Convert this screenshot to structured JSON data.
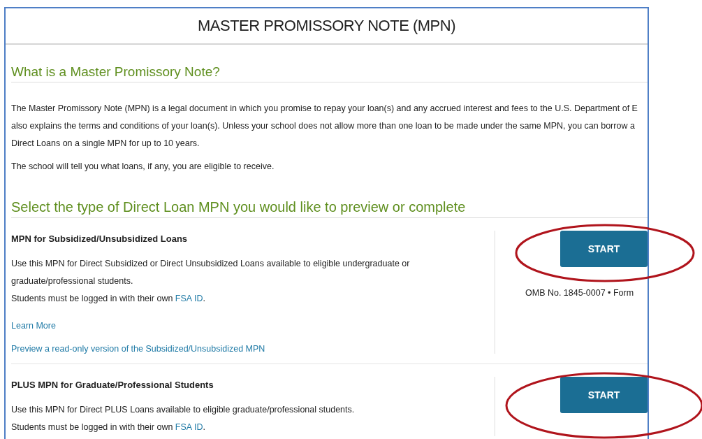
{
  "page_title": "MASTER PROMISSORY NOTE (MPN)",
  "intro": {
    "heading": "What is a Master Promissory Note?",
    "paragraph_lines": [
      "The Master Promissory Note (MPN) is a legal document in which you promise to repay your loan(s) and any accrued interest and fees to the U.S. Department of E",
      "also explains the terms and conditions of your loan(s). Unless your school does not allow more than one loan to be made under the same MPN, you can borrow a",
      "Direct Loans on a single MPN for up to 10 years."
    ],
    "note": "The school will tell you what loans, if any, you are eligible to receive."
  },
  "select_heading": "Select the type of Direct Loan MPN you would like to preview or complete",
  "mpn_options": [
    {
      "title": "MPN for Subsidized/Unsubsidized Loans",
      "description_lines": [
        "Use this MPN for Direct Subsidized or Direct Unsubsidized Loans available to eligible undergraduate or",
        "graduate/professional students."
      ],
      "login_text": "Students must be logged in with their own",
      "login_link": "FSA ID",
      "login_end": ".",
      "links": [
        "Learn More",
        "Preview a read-only version of the Subsidized/Unsubsidized MPN"
      ],
      "button": "START",
      "form_info": "OMB No. 1845-0007 • Form"
    },
    {
      "title": "PLUS MPN for Graduate/Professional Students",
      "description_lines": [
        "Use this MPN for Direct PLUS Loans available to eligible graduate/professional students."
      ],
      "login_text": "Students must be logged in with their own",
      "login_link": "FSA ID",
      "login_end": ".",
      "button": "START"
    }
  ],
  "annotations": [
    {
      "kind": "ellipse"
    },
    {
      "kind": "ellipse"
    }
  ]
}
